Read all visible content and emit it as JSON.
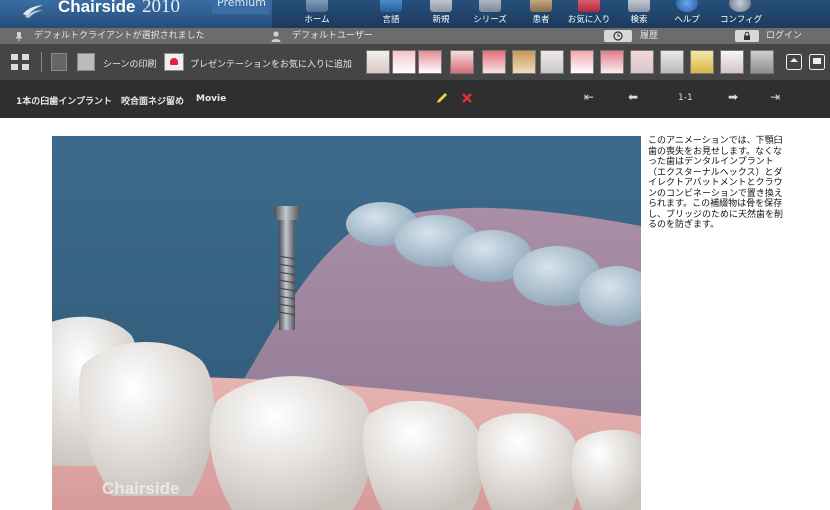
{
  "app": {
    "name": "Chairside",
    "year": "2010",
    "edition": "Premium"
  },
  "nav": [
    {
      "label": "ホーム",
      "icon": "home-icon"
    },
    {
      "label": "言語",
      "icon": "language-icon"
    },
    {
      "label": "新規",
      "icon": "new-icon"
    },
    {
      "label": "シリーズ",
      "icon": "series-icon"
    },
    {
      "label": "患者",
      "icon": "patient-icon"
    },
    {
      "label": "お気に入り",
      "icon": "favorites-icon"
    },
    {
      "label": "検索",
      "icon": "search-icon"
    },
    {
      "label": "ヘルプ",
      "icon": "help-icon"
    },
    {
      "label": "コンフィグ",
      "icon": "config-icon"
    }
  ],
  "status": {
    "client": "デフォルトクライアントが選択されました",
    "user": "デフォルトユーザー",
    "history": "履歴",
    "login": "ログイン"
  },
  "toolbar": {
    "print": "シーンの印刷",
    "add_favorite": "プレゼンテーションをお気に入りに追加"
  },
  "scene": {
    "title": "1本の臼歯インプラント　咬合面ネジ留め",
    "type": "Movie",
    "page": "1-1",
    "watermark": "Chairside",
    "description": "このアニメーションでは、下顎臼歯の喪失をお見せします。なくなった歯はデンタルインプラント（エクスターナルヘックス）とダイレクトアバットメントとクラウンのコンビネーションで置き換えられます。この補綴物は骨を保存し、ブリッジのために天然歯を削るのを防ぎます。"
  },
  "colors": {
    "accent": "#f2d14a",
    "danger": "#e83030",
    "scene_bg": "#3d6a8c",
    "gum": "#d79a9a"
  }
}
